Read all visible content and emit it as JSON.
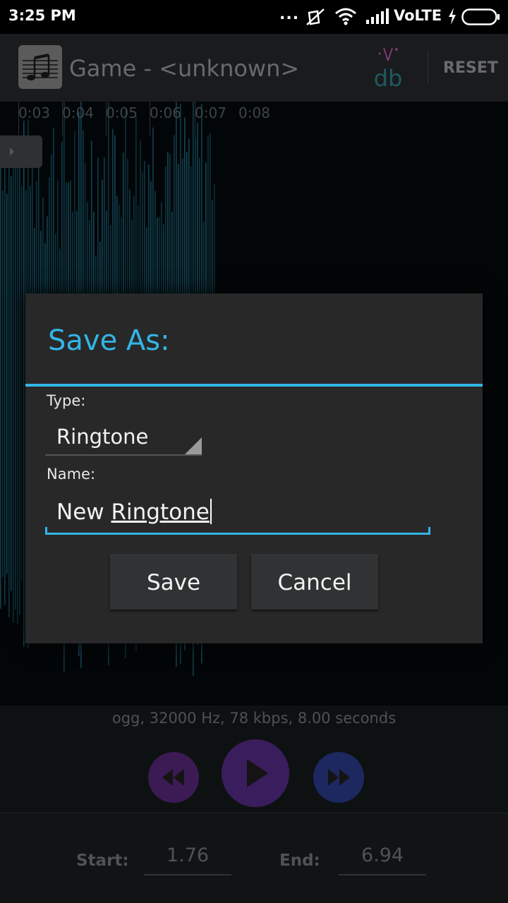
{
  "status_bar": {
    "time": "3:25 PM",
    "dots": "...",
    "network_label": "VoLTE",
    "icons": [
      "mute-icon",
      "wifi-icon",
      "signal-icon",
      "charging-icon",
      "battery-icon"
    ]
  },
  "toolbar": {
    "title": "Game - <unknown>",
    "reset_label": "RESET",
    "icons": [
      "music-note-icon",
      "db-logo-icon"
    ]
  },
  "timeline": {
    "ticks": [
      "0:03",
      "0:04",
      "0:05",
      "0:06",
      "0:07",
      "0:08"
    ]
  },
  "file_info": "ogg, 32000 Hz, 78 kbps, 8.00 seconds",
  "controls": {
    "icons": [
      "rewind-icon",
      "play-icon",
      "fast-forward-icon"
    ]
  },
  "range": {
    "start_label": "Start:",
    "start_value": "1.76",
    "end_label": "End:",
    "end_value": "6.94"
  },
  "dialog": {
    "title": "Save As:",
    "type_label": "Type:",
    "type_value": "Ringtone",
    "name_label": "Name:",
    "name_value_first": "New",
    "name_value_second": "Ringtone",
    "save_label": "Save",
    "cancel_label": "Cancel"
  },
  "colors": {
    "accent": "#33b5e5",
    "waveform": "#1e7088",
    "dialog_bg": "#282828"
  }
}
